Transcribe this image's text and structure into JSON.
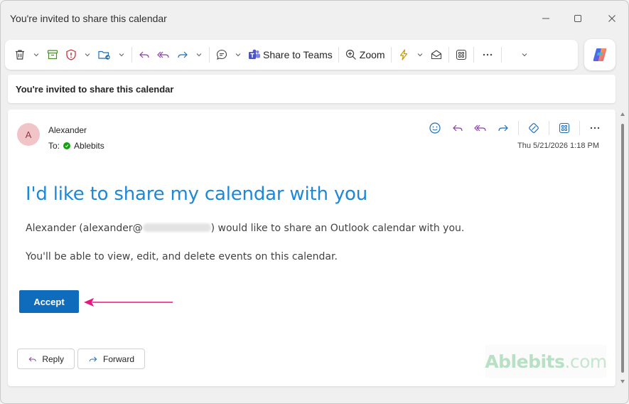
{
  "window": {
    "title": "You're invited to share this calendar"
  },
  "ribbon": {
    "share_teams_label": "Share to Teams",
    "zoom_label": "Zoom",
    "more_label": "···"
  },
  "subject": "You're invited to share this calendar",
  "message": {
    "avatar_initial": "A",
    "sender": "Alexander",
    "to_prefix": "To:",
    "recipient": "Ablebits",
    "date": "Thu 5/21/2026 1:18 PM",
    "heading": "I'd like to share my calendar with you",
    "line1_before": "Alexander (alexander@",
    "line1_after": ") would like to share an Outlook calendar with you.",
    "line2": "You'll be able to view, edit, and delete events on this calendar.",
    "accept_label": "Accept",
    "reply_label": "Reply",
    "forward_label": "Forward",
    "more_label": "···"
  },
  "watermark": {
    "brand": "Ablebits",
    "suffix": ".com"
  },
  "colors": {
    "accent": "#0f6cbd",
    "heading": "#1e88d8",
    "arrow": "#e8177d",
    "presence": "#13a10e"
  },
  "icons": [
    "trash-icon",
    "archive-icon",
    "report-icon",
    "move-to-folder-icon",
    "reply-icon",
    "reply-all-icon",
    "forward-icon",
    "chat-icon",
    "teams-icon",
    "zoom-icon",
    "lightning-icon",
    "mail-read-icon",
    "apps-icon",
    "more-icon",
    "copilot-icon",
    "emoji-icon",
    "loop-icon",
    "minimize-icon",
    "maximize-icon",
    "close-icon"
  ]
}
